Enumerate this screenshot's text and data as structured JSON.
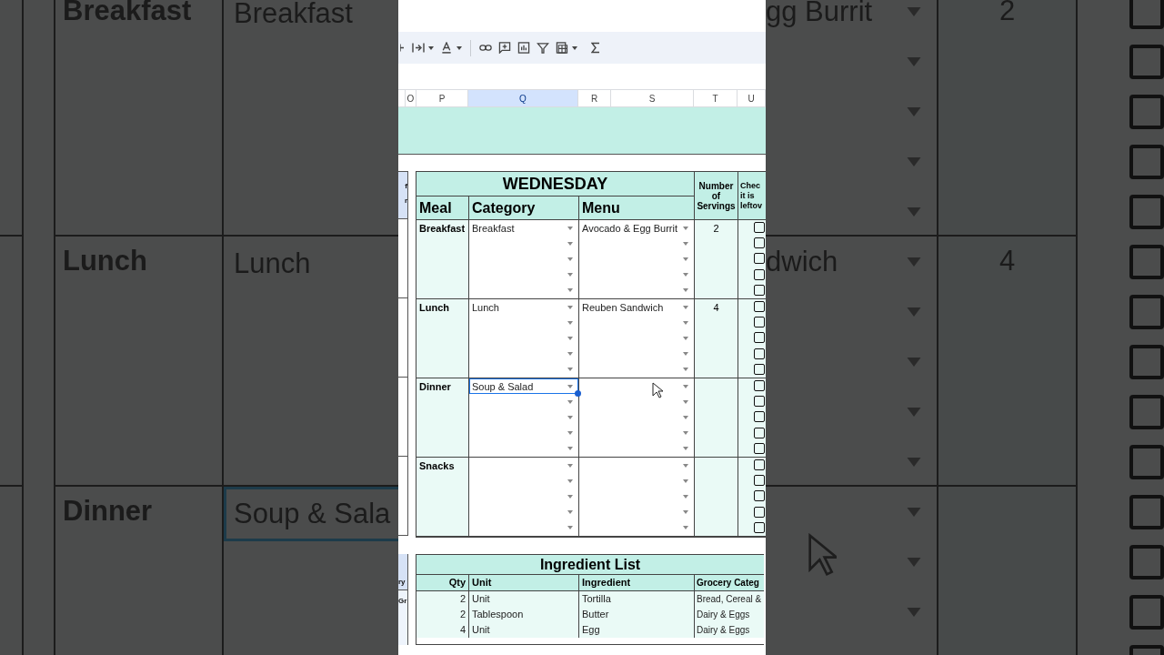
{
  "backdrop_left": {
    "rows": [
      {
        "meal": "Breakfast",
        "category": "Breakfast",
        "selected": false
      },
      {
        "meal": "Lunch",
        "category": "Lunch",
        "selected": false
      },
      {
        "meal": "Dinner",
        "category": "Soup & Sala",
        "selected": true
      }
    ]
  },
  "backdrop_right": {
    "rows": [
      {
        "menu": "gg Burrit",
        "servings": "2",
        "leftover": [
          false,
          false,
          false,
          false,
          false
        ]
      },
      {
        "menu": "dwich",
        "servings": "4",
        "leftover": [
          false,
          false,
          false,
          false,
          false
        ]
      },
      {
        "leftover": [
          false,
          false,
          false,
          false
        ]
      }
    ]
  },
  "column_headers": [
    {
      "label": "O",
      "selected": false
    },
    {
      "label": "P",
      "selected": false
    },
    {
      "label": "Q",
      "selected": true
    },
    {
      "label": "R",
      "selected": false
    },
    {
      "label": "S",
      "selected": false
    },
    {
      "label": "T",
      "selected": false
    },
    {
      "label": "U",
      "selected": false
    }
  ],
  "left_edge": {
    "planner": [
      "f",
      "r"
    ],
    "ingredients": [
      "ry",
      "Gr"
    ]
  },
  "planner": {
    "title": "WEDNESDAY",
    "headers": [
      "Meal",
      "Category",
      "Menu"
    ],
    "servings_header": [
      "Number",
      "of",
      "Servings"
    ],
    "leftover_header": [
      "Chec",
      "it is",
      "leftov"
    ],
    "meals": [
      {
        "meal": "Breakfast",
        "servings": "2",
        "slots": [
          {
            "category": "Breakfast",
            "menu": "Avocado & Egg Burrit",
            "selected": false,
            "leftover": false
          },
          {
            "selected": false,
            "leftover": false
          },
          {
            "selected": false,
            "leftover": false
          },
          {
            "selected": false,
            "leftover": false
          },
          {
            "selected": false,
            "leftover": false
          }
        ]
      },
      {
        "meal": "Lunch",
        "servings": "4",
        "slots": [
          {
            "category": "Lunch",
            "menu": "Reuben Sandwich",
            "selected": false,
            "leftover": false
          },
          {
            "selected": false,
            "leftover": false
          },
          {
            "selected": false,
            "leftover": false
          },
          {
            "selected": false,
            "leftover": false
          },
          {
            "selected": false,
            "leftover": false
          }
        ]
      },
      {
        "meal": "Dinner",
        "slots": [
          {
            "category": "Soup & Salad",
            "selected": true,
            "leftover": false
          },
          {
            "selected": false,
            "leftover": false
          },
          {
            "selected": false,
            "leftover": false
          },
          {
            "selected": false,
            "leftover": false
          },
          {
            "selected": false,
            "leftover": false
          }
        ]
      },
      {
        "meal": "Snacks",
        "slots": [
          {
            "selected": false,
            "leftover": false
          },
          {
            "selected": false,
            "leftover": false
          },
          {
            "selected": false,
            "leftover": false
          },
          {
            "selected": false,
            "leftover": false
          },
          {
            "selected": false,
            "leftover": false
          }
        ]
      }
    ]
  },
  "ingredients": {
    "title": "Ingredient List",
    "headers": [
      "Qty",
      "Unit",
      "Ingredient",
      "Grocery Categ"
    ],
    "rows": [
      [
        "2",
        "Unit",
        "Tortilla",
        "Bread, Cereal &"
      ],
      [
        "2",
        "Tablespoon",
        "Butter",
        "Dairy & Eggs"
      ],
      [
        "4",
        "Unit",
        "Egg",
        "Dairy & Eggs"
      ]
    ]
  }
}
